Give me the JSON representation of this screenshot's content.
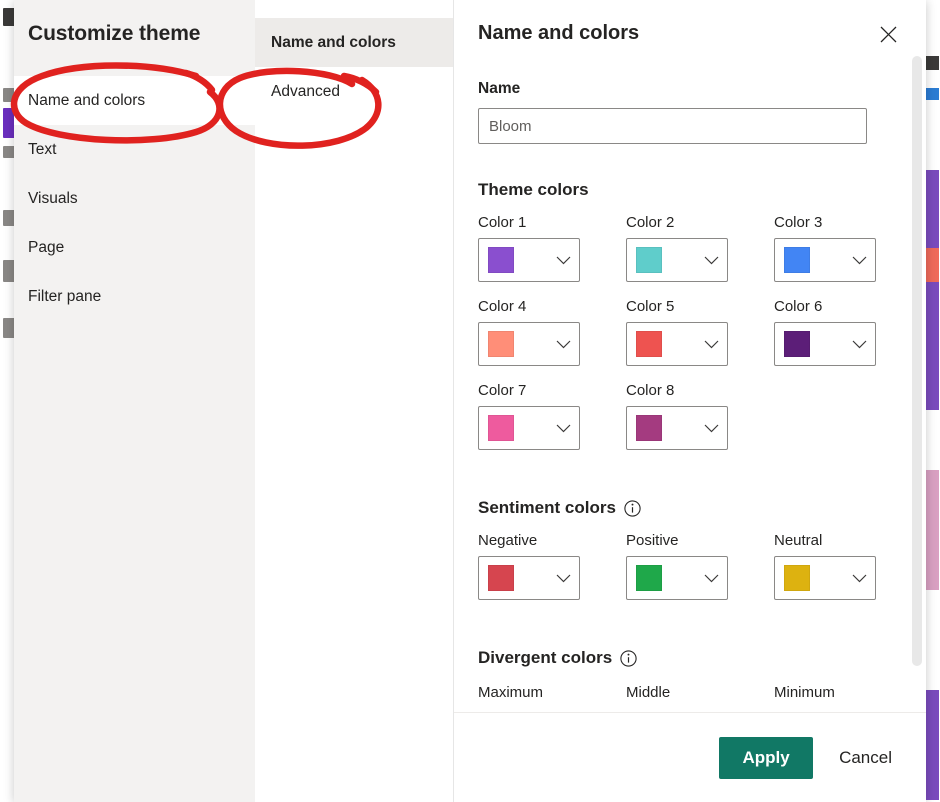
{
  "dialog": {
    "title": "Customize theme",
    "nav": {
      "items": [
        {
          "label": "Name and colors",
          "selected": true
        },
        {
          "label": "Text",
          "selected": false
        },
        {
          "label": "Visuals",
          "selected": false
        },
        {
          "label": "Page",
          "selected": false
        },
        {
          "label": "Filter pane",
          "selected": false
        }
      ]
    },
    "tabs": {
      "items": [
        {
          "label": "Name and colors",
          "selected": true
        },
        {
          "label": "Advanced",
          "selected": false
        }
      ]
    },
    "pane": {
      "title": "Name and colors",
      "close_icon": "close-icon",
      "name": {
        "label": "Name",
        "value": "",
        "placeholder": "Bloom"
      },
      "theme_colors": {
        "title": "Theme colors",
        "swatches": [
          {
            "label": "Color 1",
            "color": "#8A4FCF"
          },
          {
            "label": "Color 2",
            "color": "#5FCDCB"
          },
          {
            "label": "Color 3",
            "color": "#4285F4"
          },
          {
            "label": "Color 4",
            "color": "#FF8E78"
          },
          {
            "label": "Color 5",
            "color": "#EE5350"
          },
          {
            "label": "Color 6",
            "color": "#5C1E78"
          },
          {
            "label": "Color 7",
            "color": "#EE5B9E"
          },
          {
            "label": "Color 8",
            "color": "#A43B80"
          }
        ]
      },
      "sentiment_colors": {
        "title": "Sentiment colors",
        "info_icon": "info-icon",
        "swatches": [
          {
            "label": "Negative",
            "color": "#D6454F"
          },
          {
            "label": "Positive",
            "color": "#1FA84A"
          },
          {
            "label": "Neutral",
            "color": "#DDB210"
          }
        ]
      },
      "divergent_colors": {
        "title": "Divergent colors",
        "info_icon": "info-icon",
        "clipped_labels": [
          "Maximum",
          "Middle",
          "Minimum"
        ]
      }
    },
    "footer": {
      "apply_label": "Apply",
      "cancel_label": "Cancel",
      "apply_color": "#117865"
    }
  },
  "annotations": {
    "ink_color": "#E0221F",
    "circles": [
      {
        "target": "nav-item-name-and-colors"
      },
      {
        "target": "tab-item-advanced"
      }
    ]
  }
}
